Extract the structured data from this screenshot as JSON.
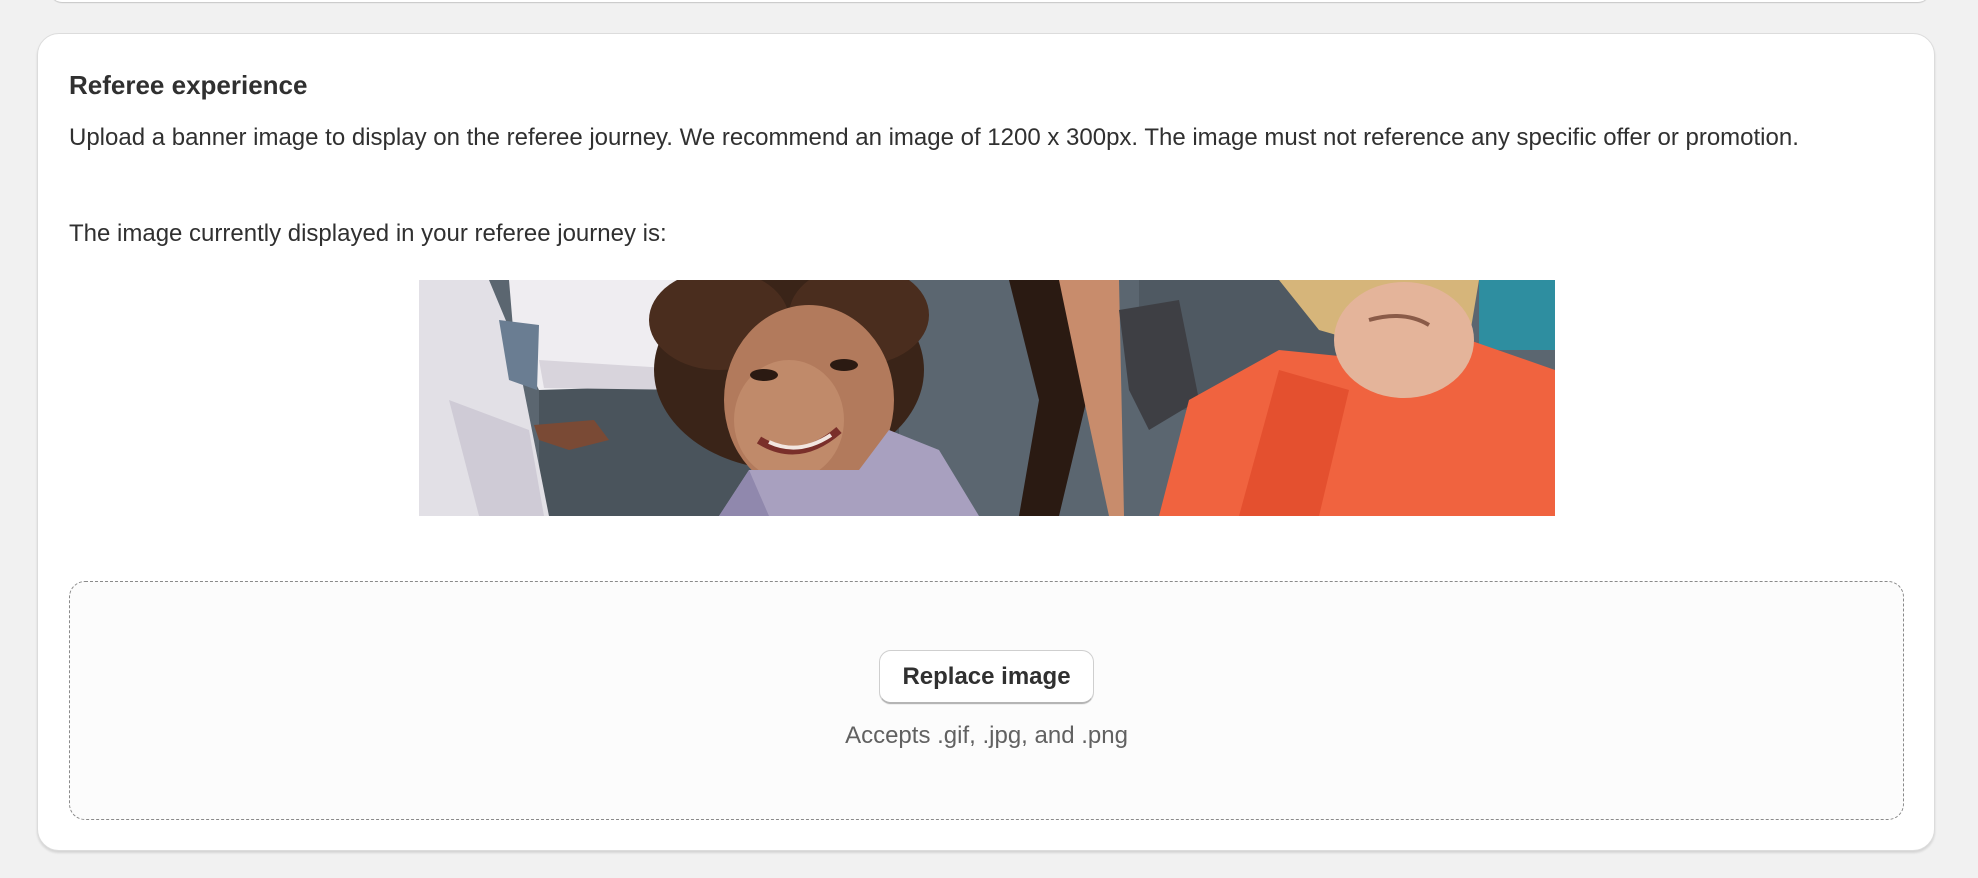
{
  "section": {
    "title": "Referee experience",
    "description": "Upload a banner image to display on the referee journey. We recommend an image of 1200 x 300px. The image must not reference any specific offer or promotion.",
    "current_image_text": "The image currently displayed in your referee journey is:"
  },
  "banner_image": {
    "icon": "photo-banner"
  },
  "dropzone": {
    "button_label": "Replace image",
    "accepts_text": "Accepts .gif, .jpg, and .png"
  },
  "colors": {
    "page_background": "#f1f1f1",
    "card_background": "#ffffff",
    "text_primary": "#303030",
    "text_secondary": "#616161",
    "dropzone_border": "#8a8a8a"
  }
}
